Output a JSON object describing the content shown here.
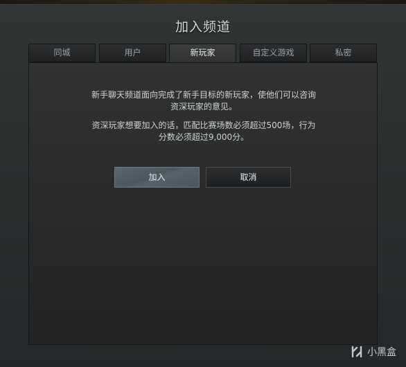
{
  "dialog": {
    "title": "加入频道"
  },
  "tabs": [
    {
      "label": "同城"
    },
    {
      "label": "用户"
    },
    {
      "label": "新玩家",
      "active": true
    },
    {
      "label": "自定义游戏"
    },
    {
      "label": "私密"
    }
  ],
  "panel": {
    "description": "新手聊天频道面向完成了新手目标的新玩家，使他们可以咨询资深玩家的意见。",
    "requirement": "资深玩家想要加入的话，匹配比赛场数必须超过500场，行为分数必须超过9,000分。"
  },
  "buttons": {
    "join_label": "加入",
    "cancel_label": "取消"
  },
  "watermark": {
    "text": "小黑盒"
  }
}
